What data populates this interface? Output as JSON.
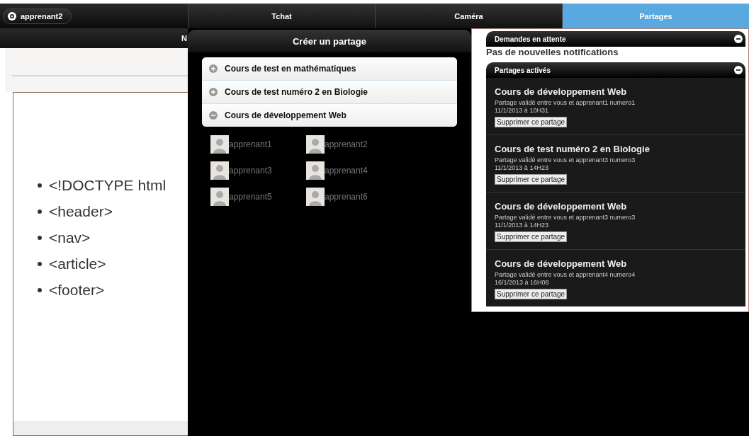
{
  "user_button": {
    "label": "apprenant2"
  },
  "tabs": [
    {
      "label": "Tchat",
      "selected": false
    },
    {
      "label": "Caméra",
      "selected": false
    },
    {
      "label": "Partages",
      "selected": true
    }
  ],
  "slide_page": {
    "header_title": "N",
    "bullets": [
      "<!DOCTYPE html",
      "<header>",
      "<nav>",
      "<article>",
      "<footer>"
    ]
  },
  "create_panel": {
    "title": "Créer un partage",
    "courses": [
      {
        "label": "Cours de test en mathématiques",
        "expanded": false
      },
      {
        "label": "Cours de test numéro 2 en Biologie",
        "expanded": false
      },
      {
        "label": "Cours de développement Web",
        "expanded": true
      }
    ],
    "learners": [
      "apprenant1",
      "apprenant2",
      "apprenant3",
      "apprenant4",
      "apprenant5",
      "apprenant6"
    ]
  },
  "sections": [
    {
      "title": "Demandes en attente",
      "expanded": true,
      "message": "Pas de nouvelles notifications"
    },
    {
      "title": "Partages activés",
      "expanded": true,
      "shares": [
        {
          "course": "Cours de développement Web",
          "detail": "Partage validé entre vous et apprenant1 numero1",
          "date": "11/1/2013 à 10H31",
          "button": "Supprimer ce partage"
        },
        {
          "course": "Cours de test numéro 2 en Biologie",
          "detail": "Partage validé entre vous et apprenant3 numero3",
          "date": "11/1/2013 à 14H23",
          "button": "Supprimer ce partage"
        },
        {
          "course": "Cours de développement Web",
          "detail": "Partage validé entre vous et apprenant3 numero3",
          "date": "11/1/2013 à 14H23",
          "button": "Supprimer ce partage"
        },
        {
          "course": "Cours de développement Web",
          "detail": "Partage validé entre vous et apprenant4 numero4",
          "date": "16/1/2013 à 16H08",
          "button": "Supprimer ce partage"
        }
      ]
    }
  ]
}
